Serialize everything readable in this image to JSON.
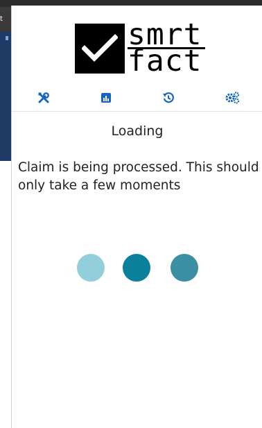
{
  "background": {
    "tab_text": "t"
  },
  "logo": {
    "line1": "smrt",
    "line2": "fact"
  },
  "toolbar": {
    "items": [
      {
        "icon": "tools-icon"
      },
      {
        "icon": "chart-icon"
      },
      {
        "icon": "history-icon"
      },
      {
        "icon": "settings-icon"
      }
    ],
    "icon_color": "#1565c0"
  },
  "main": {
    "heading": "Loading",
    "message": "Claim is being processed. This should only take a few moments"
  },
  "loader": {
    "colors": [
      "#92cfdb",
      "#0a809c",
      "#3a8fa3"
    ]
  }
}
